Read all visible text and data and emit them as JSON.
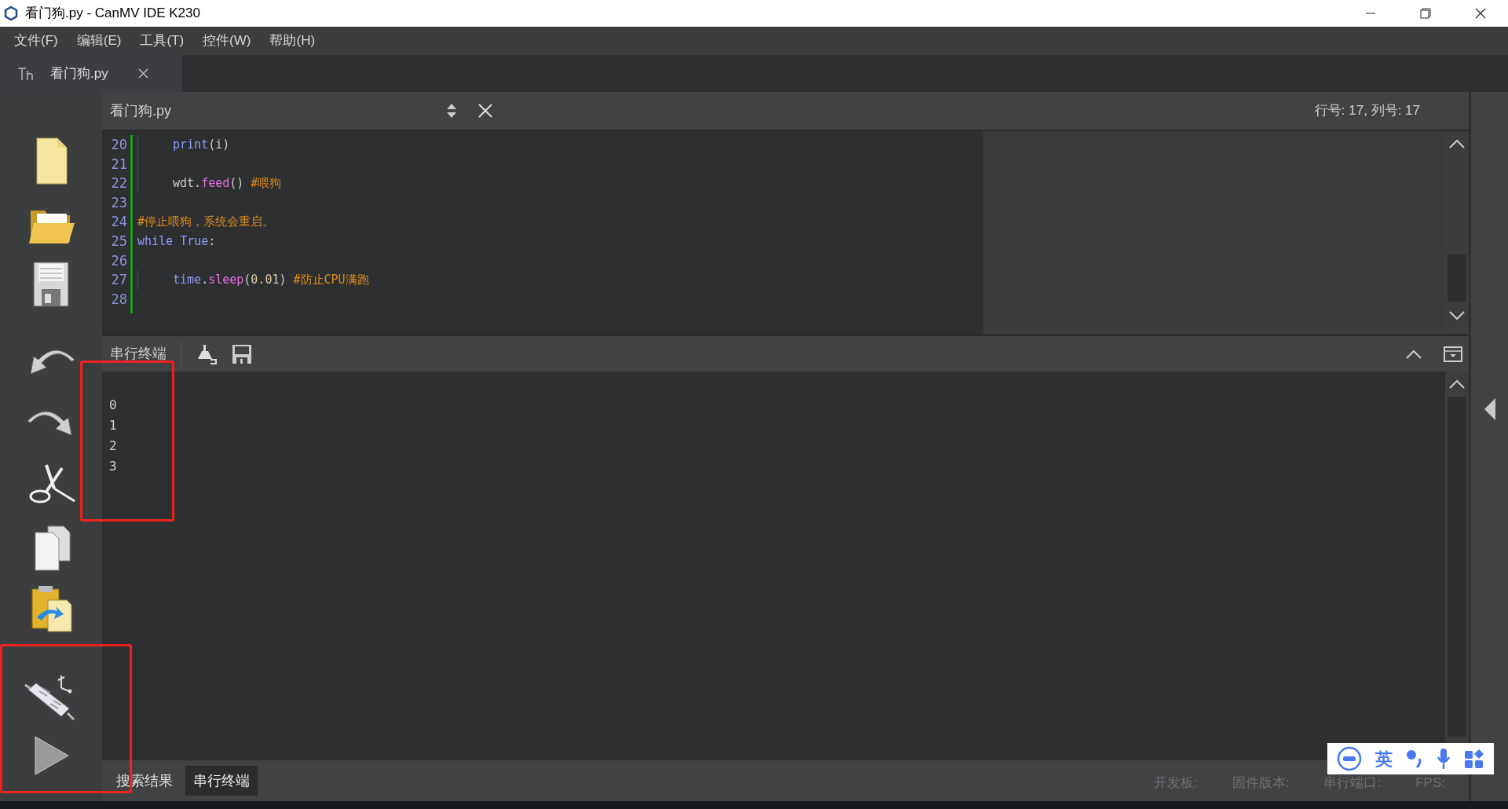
{
  "window": {
    "title": "看门狗.py - CanMV IDE K230"
  },
  "menu": [
    "文件(F)",
    "编辑(E)",
    "工具(T)",
    "控件(W)",
    "帮助(H)"
  ],
  "file_tabs": [
    {
      "label": "看门狗.py",
      "selected": true
    }
  ],
  "editor": {
    "file_name": "看门狗.py",
    "position": "行号: 17, 列号: 17",
    "lines": [
      {
        "number": "20",
        "indent": true,
        "tokens": [
          {
            "kind": "kw",
            "text": "print"
          },
          {
            "kind": "plain",
            "text": "(i)"
          }
        ]
      },
      {
        "number": "21",
        "indent": true
      },
      {
        "number": "22",
        "indent": true,
        "tokens": [
          {
            "kind": "plain",
            "text": "wdt."
          },
          {
            "kind": "fn",
            "text": "feed"
          },
          {
            "kind": "plain",
            "text": "() "
          },
          {
            "kind": "comment",
            "text": "#喂狗"
          }
        ]
      },
      {
        "number": "23",
        "indent": false
      },
      {
        "number": "24",
        "indent": false,
        "tokens": [
          {
            "kind": "comment",
            "text": "#停止喂狗，系统会重启。"
          }
        ]
      },
      {
        "number": "25",
        "indent": false,
        "tokens": [
          {
            "kind": "kw",
            "text": "while True"
          },
          {
            "kind": "plain",
            "text": ":"
          }
        ]
      },
      {
        "number": "26",
        "indent": false
      },
      {
        "number": "27",
        "indent": true,
        "tokens": [
          {
            "kind": "kw",
            "text": "time"
          },
          {
            "kind": "plain",
            "text": "."
          },
          {
            "kind": "fn",
            "text": "sleep"
          },
          {
            "kind": "plain",
            "text": "("
          },
          {
            "kind": "num",
            "text": "0.01"
          },
          {
            "kind": "plain",
            "text": ") "
          },
          {
            "kind": "comment",
            "text": "#防止CPU满跑"
          }
        ]
      },
      {
        "number": "28",
        "indent": false
      }
    ]
  },
  "terminal": {
    "title": "串行终端",
    "output": [
      "0",
      "1",
      "2",
      "3"
    ]
  },
  "bottom_tabs": [
    {
      "label": "搜索结果",
      "selected": false
    },
    {
      "label": "串行终端",
      "selected": true
    }
  ],
  "status": [
    "开发板:",
    "固件版本:",
    "串行端口:",
    "FPS:"
  ],
  "ime": {
    "label": "英"
  }
}
